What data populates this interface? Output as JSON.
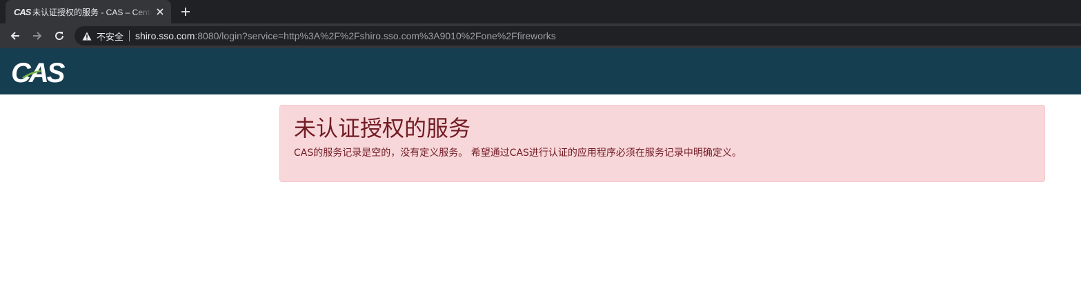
{
  "browser": {
    "tab": {
      "favicon_text": "CAS",
      "title": "未认证授权的服务 - CAS – Central Authentication Service"
    },
    "toolbar": {
      "security_label": "不安全",
      "url_host": "shiro.sso.com",
      "url_rest": ":8080/login?service=http%3A%2F%2Fshiro.sso.com%3A9010%2Fone%2Ffireworks"
    },
    "icons": {
      "back": "back-arrow-icon",
      "forward": "forward-arrow-icon",
      "reload": "reload-icon",
      "warning": "warning-icon",
      "close": "close-icon",
      "new_tab": "plus-icon"
    }
  },
  "header": {
    "logo_text": "CAS",
    "background_color": "#153e50"
  },
  "alert": {
    "title": "未认证授权的服务",
    "message": "CAS的服务记录是空的，没有定义服务。 希望通过CAS进行认证的应用程序必须在服务记录中明确定义。",
    "background_color": "#f8d7da",
    "text_color": "#721c24"
  }
}
